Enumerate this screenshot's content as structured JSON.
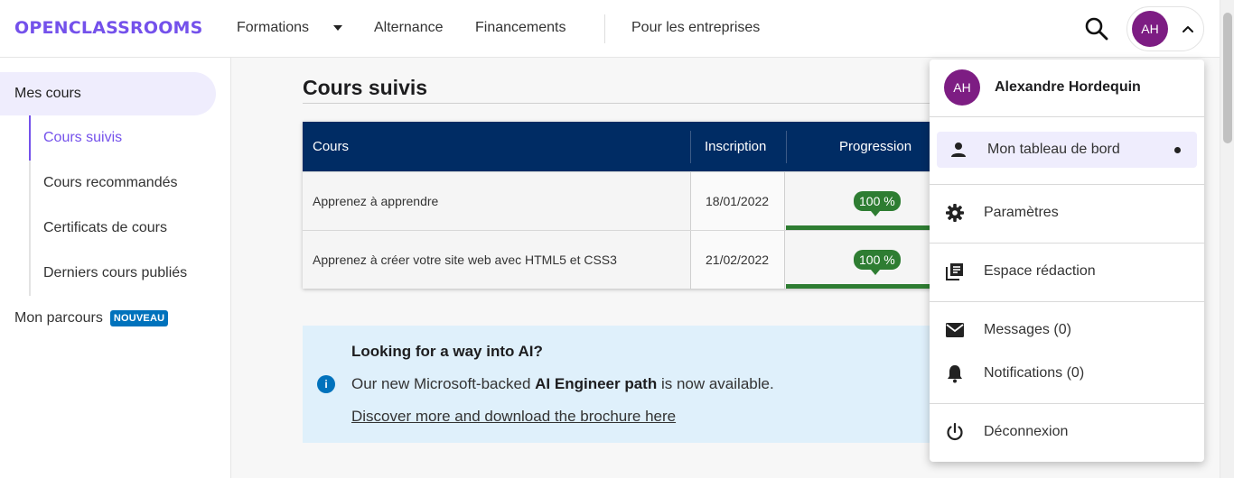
{
  "header": {
    "logo": "OPENCLASSROOMS",
    "nav": {
      "formations": "Formations",
      "alternance": "Alternance",
      "financements": "Financements",
      "entreprises": "Pour les entreprises"
    },
    "user_initials": "AH"
  },
  "sidebar": {
    "main_label": "Mes cours",
    "items": [
      {
        "label": "Cours suivis"
      },
      {
        "label": "Cours recommandés"
      },
      {
        "label": "Certificats de cours"
      },
      {
        "label": "Derniers cours publiés"
      }
    ],
    "parcours_label": "Mon parcours",
    "new_badge": "NOUVEAU"
  },
  "main": {
    "title": "Cours suivis",
    "table": {
      "headers": {
        "cours": "Cours",
        "inscription": "Inscription",
        "progression": "Progression"
      },
      "rows": [
        {
          "cours": "Apprenez à apprendre",
          "inscription": "18/01/2022",
          "progress_label": "100 %",
          "progress": 1.0
        },
        {
          "cours": "Apprenez à créer votre site web avec HTML5 et CSS3",
          "inscription": "21/02/2022",
          "progress_label": "100 %",
          "progress": 1.0
        }
      ]
    },
    "banner": {
      "title": "Looking for a way into AI?",
      "text_before": "Our new Microsoft-backed ",
      "text_bold": "AI Engineer path",
      "text_after": " is now available.",
      "link": "Discover more and download the brochure here"
    }
  },
  "dropdown": {
    "initials": "AH",
    "name": "Alexandre Hordequin",
    "items": {
      "dashboard": "Mon tableau de bord",
      "settings": "Paramètres",
      "editorial": "Espace rédaction",
      "messages": "Messages (0)",
      "notifications": "Notifications (0)",
      "logout": "Déconnexion"
    }
  },
  "colors": {
    "brand": "#7451eb",
    "table_header": "#002c64",
    "progress": "#2e7d32",
    "avatar": "#7d1d83",
    "badge": "#0072bc"
  }
}
